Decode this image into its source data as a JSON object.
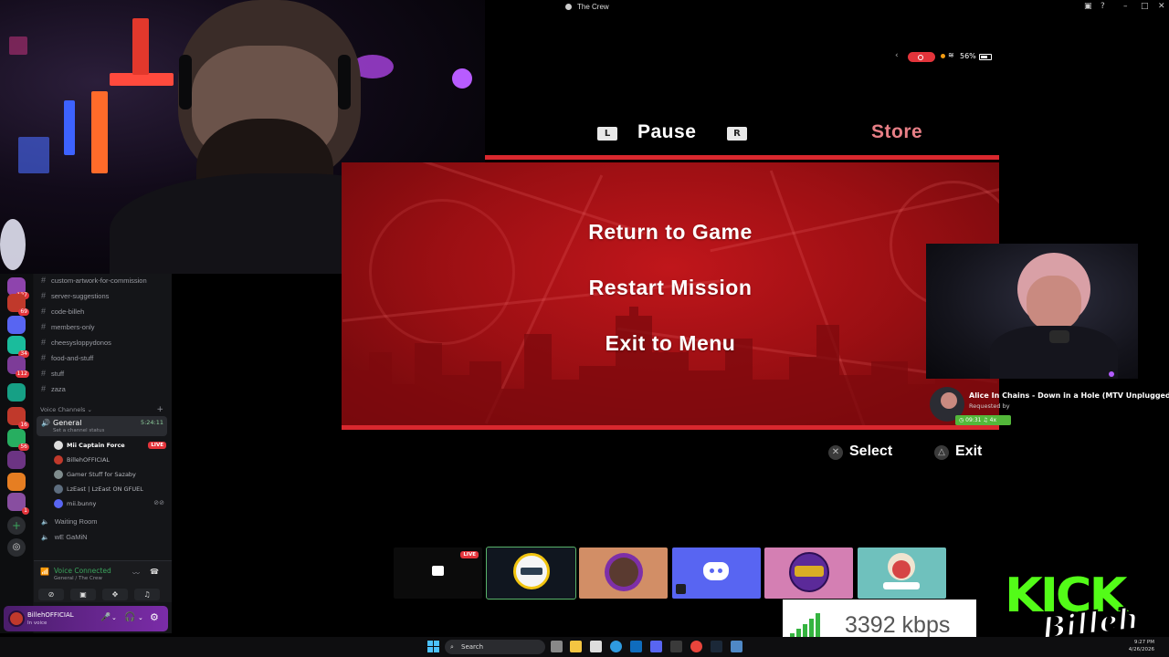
{
  "window": {
    "title": "The Crew"
  },
  "status": {
    "battery": "56%"
  },
  "game": {
    "tabs": {
      "left_key": "L",
      "right_key": "R",
      "active": "Pause",
      "other": "Store"
    },
    "menu": [
      "Return to Game",
      "Restart Mission",
      "Exit to Menu"
    ],
    "hints": {
      "select": "Select",
      "exit": "Exit",
      "select_icon": "cross-button-icon",
      "exit_icon": "triangle-button-icon"
    }
  },
  "discord": {
    "guild_badges": [
      "127",
      "69",
      "34",
      "112",
      "16",
      "56",
      "1"
    ],
    "channels": [
      "custom-artwork-for-commission",
      "server-suggestions",
      "code-billeh",
      "members-only",
      "cheesysloppydonos",
      "food-and-stuff",
      "stuff",
      "zaza"
    ],
    "voice_header": "Voice Channels",
    "voice_channel": {
      "name": "General",
      "timer": "5:24:11",
      "status": "Set a channel status"
    },
    "members": [
      {
        "name": "Mii Captain Force",
        "live": "LIVE"
      },
      {
        "name": "BillehOFFICIAL"
      },
      {
        "name": "Gamer Stuff for Sazaby"
      },
      {
        "name": "LzEast | LzEast ON GFUEL"
      },
      {
        "name": "mii.bunny"
      }
    ],
    "other_voice": [
      "Waiting Room",
      "wE GaMiN"
    ],
    "voice_connected": "Voice Connected",
    "voice_sub": "General / The Crew",
    "user": {
      "name": "BillehOFFICIAL",
      "status": "In voice"
    }
  },
  "music": {
    "title": "Alice In Chains - Down in a Hole (MTV Unplugged...",
    "requested_by": "Requested by",
    "time": "09:31",
    "count": "4x"
  },
  "scenes": {
    "live_badge": "LIVE"
  },
  "stream": {
    "bitrate": "3392 kbps"
  },
  "branding": {
    "kick": "KICK",
    "signature": "Billeh"
  },
  "taskbar": {
    "search": "Search",
    "time": "9:27 PM",
    "date": "4/26/2026"
  }
}
